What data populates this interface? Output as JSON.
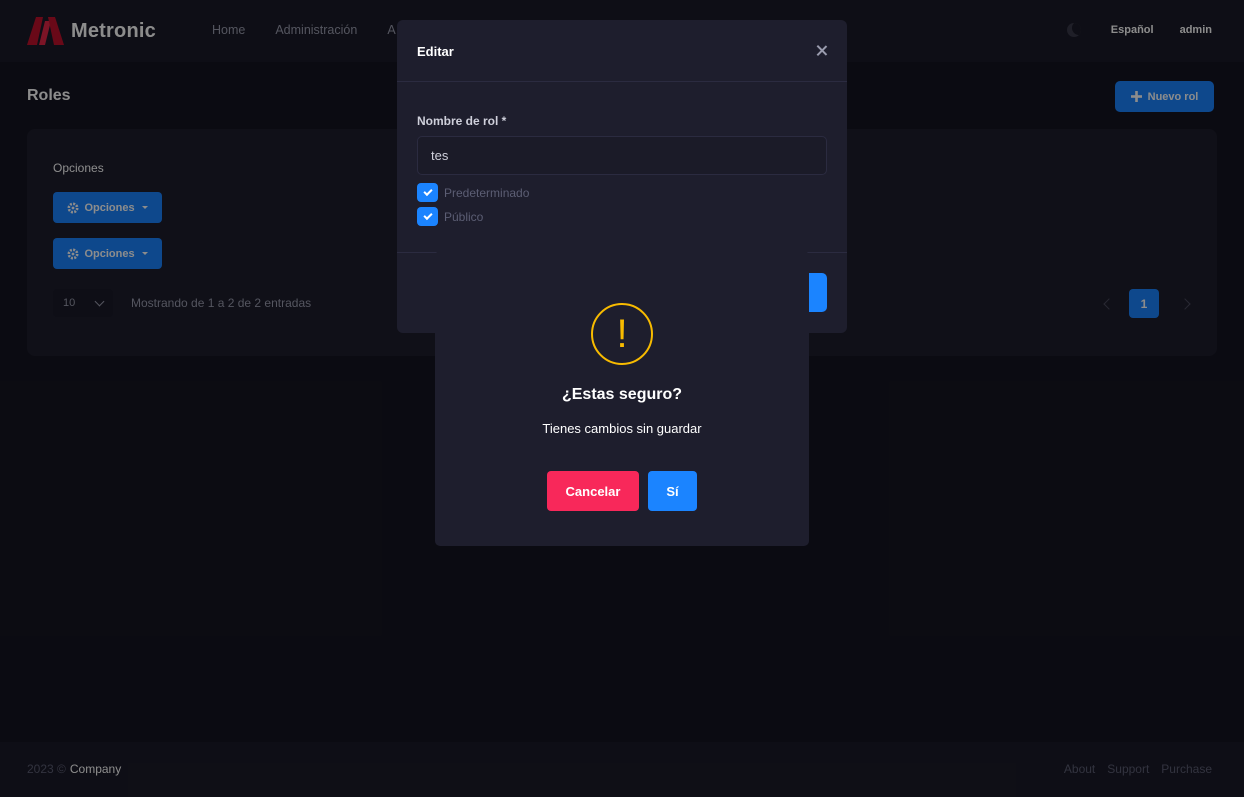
{
  "header": {
    "brand": "Metronic",
    "nav": [
      {
        "label": "Home"
      },
      {
        "label": "Administración"
      },
      {
        "label": "A"
      }
    ],
    "language": "Español",
    "user": "admin"
  },
  "page": {
    "title": "Roles",
    "new_button": "Nuevo rol"
  },
  "card": {
    "options_label": "Opciones",
    "options_button_1": "Opciones",
    "options_button_2": "Opciones",
    "page_size": "10",
    "showing": "Mostrando de 1 a 2 de 2 entradas",
    "current_page": "1"
  },
  "footer": {
    "year": "2023 ©",
    "company": "Company",
    "links": [
      {
        "label": "About"
      },
      {
        "label": "Support"
      },
      {
        "label": "Purchase"
      }
    ]
  },
  "edit_modal": {
    "title": "Editar",
    "field_label": "Nombre de rol *",
    "field_value": "tes",
    "checkboxes": [
      {
        "label": "Predeterminado",
        "checked": true
      },
      {
        "label": "Público",
        "checked": true
      }
    ]
  },
  "confirm": {
    "icon": "!",
    "title": "¿Estas seguro?",
    "text": "Tienes cambios sin guardar",
    "cancel": "Cancelar",
    "confirm": "Sí"
  },
  "colors": {
    "primary": "#1b84ff",
    "danger": "#f8285a",
    "warning": "#f8bb00",
    "background": "#151521",
    "surface": "#1e1e2d"
  }
}
